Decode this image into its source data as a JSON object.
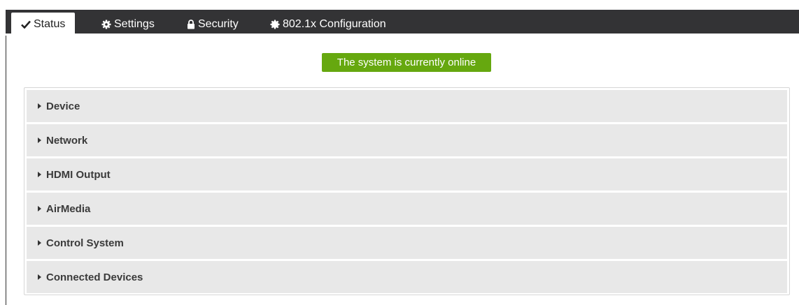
{
  "tabs": [
    {
      "label": "Status",
      "icon": "checkmark-icon",
      "active": true
    },
    {
      "label": "Settings",
      "icon": "gear-icon",
      "active": false
    },
    {
      "label": "Security",
      "icon": "lock-icon",
      "active": false
    },
    {
      "label": "802.1x Configuration",
      "icon": "cog-icon",
      "active": false
    }
  ],
  "status": {
    "message": "The system is currently online",
    "color": "#66a80f"
  },
  "accordion": [
    {
      "label": "Device"
    },
    {
      "label": "Network"
    },
    {
      "label": "HDMI Output"
    },
    {
      "label": "AirMedia"
    },
    {
      "label": "Control System"
    },
    {
      "label": "Connected Devices"
    }
  ],
  "colors": {
    "tabbar": "#333335",
    "accordion_bg": "#e8e8e8"
  }
}
